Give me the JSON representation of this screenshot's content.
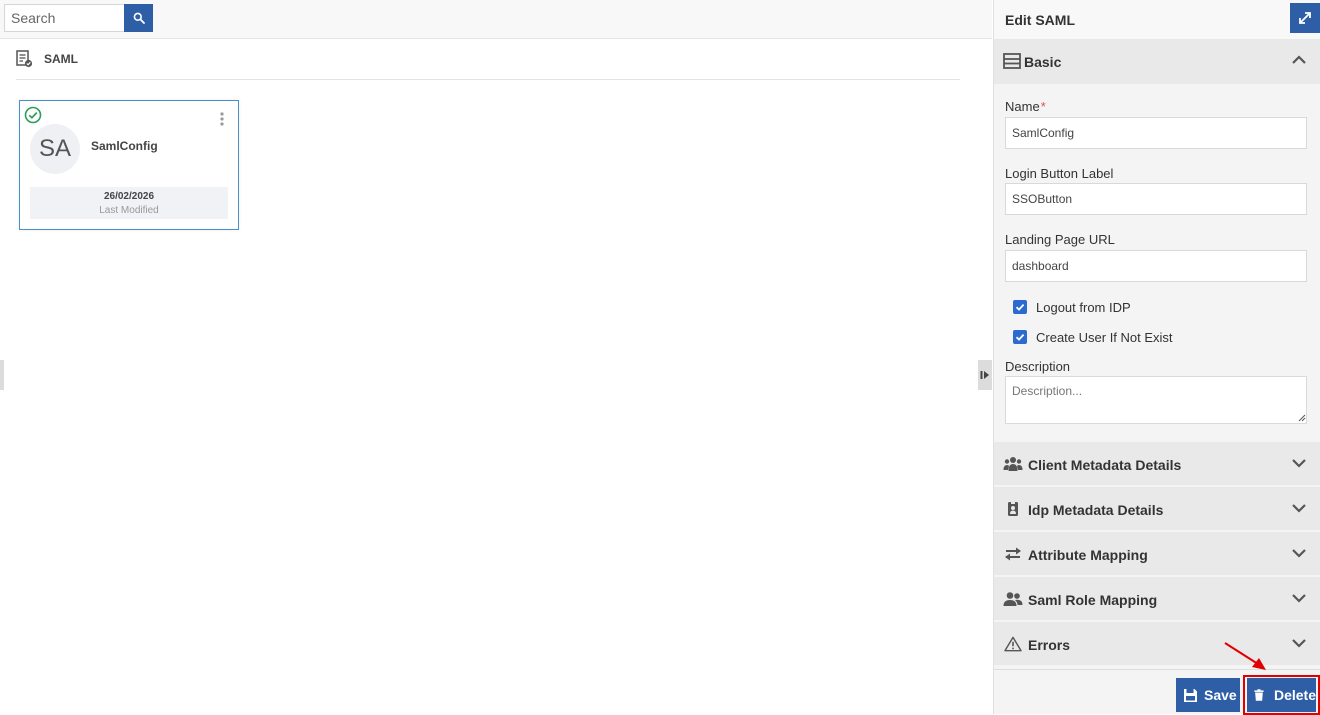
{
  "search": {
    "placeholder": "Search",
    "value": ""
  },
  "section": {
    "title": "SAML",
    "icon": "saml-doc-icon"
  },
  "cards": [
    {
      "initials": "SA",
      "name": "SamlConfig",
      "date": "26/02/2026",
      "date_caption": "Last Modified",
      "status": "active"
    }
  ],
  "panel": {
    "title": "Edit SAML",
    "basic": {
      "label": "Basic",
      "fields": {
        "name": {
          "label": "Name",
          "required_mark": "*",
          "value": "SamlConfig"
        },
        "login_button_label": {
          "label": "Login Button Label",
          "value": "SSOButton"
        },
        "landing_page_url": {
          "label": "Landing Page URL",
          "value": "dashboard"
        },
        "logout_from_idp": {
          "label": "Logout from IDP",
          "checked": true
        },
        "create_user": {
          "label": "Create User If Not Exist",
          "checked": true
        },
        "description": {
          "label": "Description",
          "placeholder": "Description...",
          "value": ""
        }
      }
    },
    "sections": [
      {
        "label": "Client Metadata Details",
        "icon": "users-icon"
      },
      {
        "label": "Idp Metadata Details",
        "icon": "id-badge-icon"
      },
      {
        "label": "Attribute Mapping",
        "icon": "exchange-icon"
      },
      {
        "label": "Saml Role Mapping",
        "icon": "user-group-icon"
      },
      {
        "label": "Errors",
        "icon": "warning-icon"
      }
    ],
    "footer": {
      "save_label": "Save",
      "delete_label": "Delete"
    }
  },
  "colors": {
    "primary": "#2d5ea6",
    "highlight": "#e00000",
    "success": "#2a9d5c",
    "required": "#d9534f"
  }
}
